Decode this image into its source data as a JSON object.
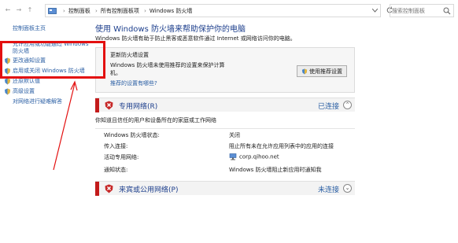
{
  "address_bar": {
    "breadcrumbs": [
      "控制面板",
      "所有控制面板项",
      "Windows 防火墙"
    ],
    "search_placeholder": "搜索控制面板"
  },
  "sidebar": {
    "home": "控制面板主页",
    "allow_line1": "允许应用或功能通过 Windows",
    "allow_line2": "防火墙",
    "notify": "更改通知设置",
    "toggle": "启用或关闭 Windows 防火墙",
    "restore": "还原默认值",
    "advanced": "高级设置",
    "troubleshoot": "对网络进行疑难解答"
  },
  "main": {
    "title": "使用 Windows 防火墙来帮助保护你的电脑",
    "intro": "Windows 防火墙有助于防止黑客或恶意软件通过 Internet 或网络访问你的电脑。",
    "update_panel": {
      "title": "更新防火墙设置",
      "line1": "Windows 防火墙未使用推荐的设置来保护计算",
      "line2": "机。",
      "link": "推荐的设置有哪些?",
      "button": "使用推荐设置"
    },
    "private_network": {
      "title": "专用网络(R)",
      "status": "已连接",
      "description": "你知道且信任的用户和设备所在的家庭或工作网络",
      "rows": [
        {
          "label": "Windows 防火墙状态:",
          "value": "关闭"
        },
        {
          "label": "传入连接:",
          "value": "阻止所有未在允许应用列表中的应用的连接"
        },
        {
          "label": "活动专用网络:",
          "value": "corp.qihoo.net"
        },
        {
          "label": "通知状态:",
          "value": "Windows 防火墙阻止新应用时通知我"
        }
      ]
    },
    "public_network": {
      "title": "来宾或公用网络(P)",
      "status": "未连接"
    }
  }
}
